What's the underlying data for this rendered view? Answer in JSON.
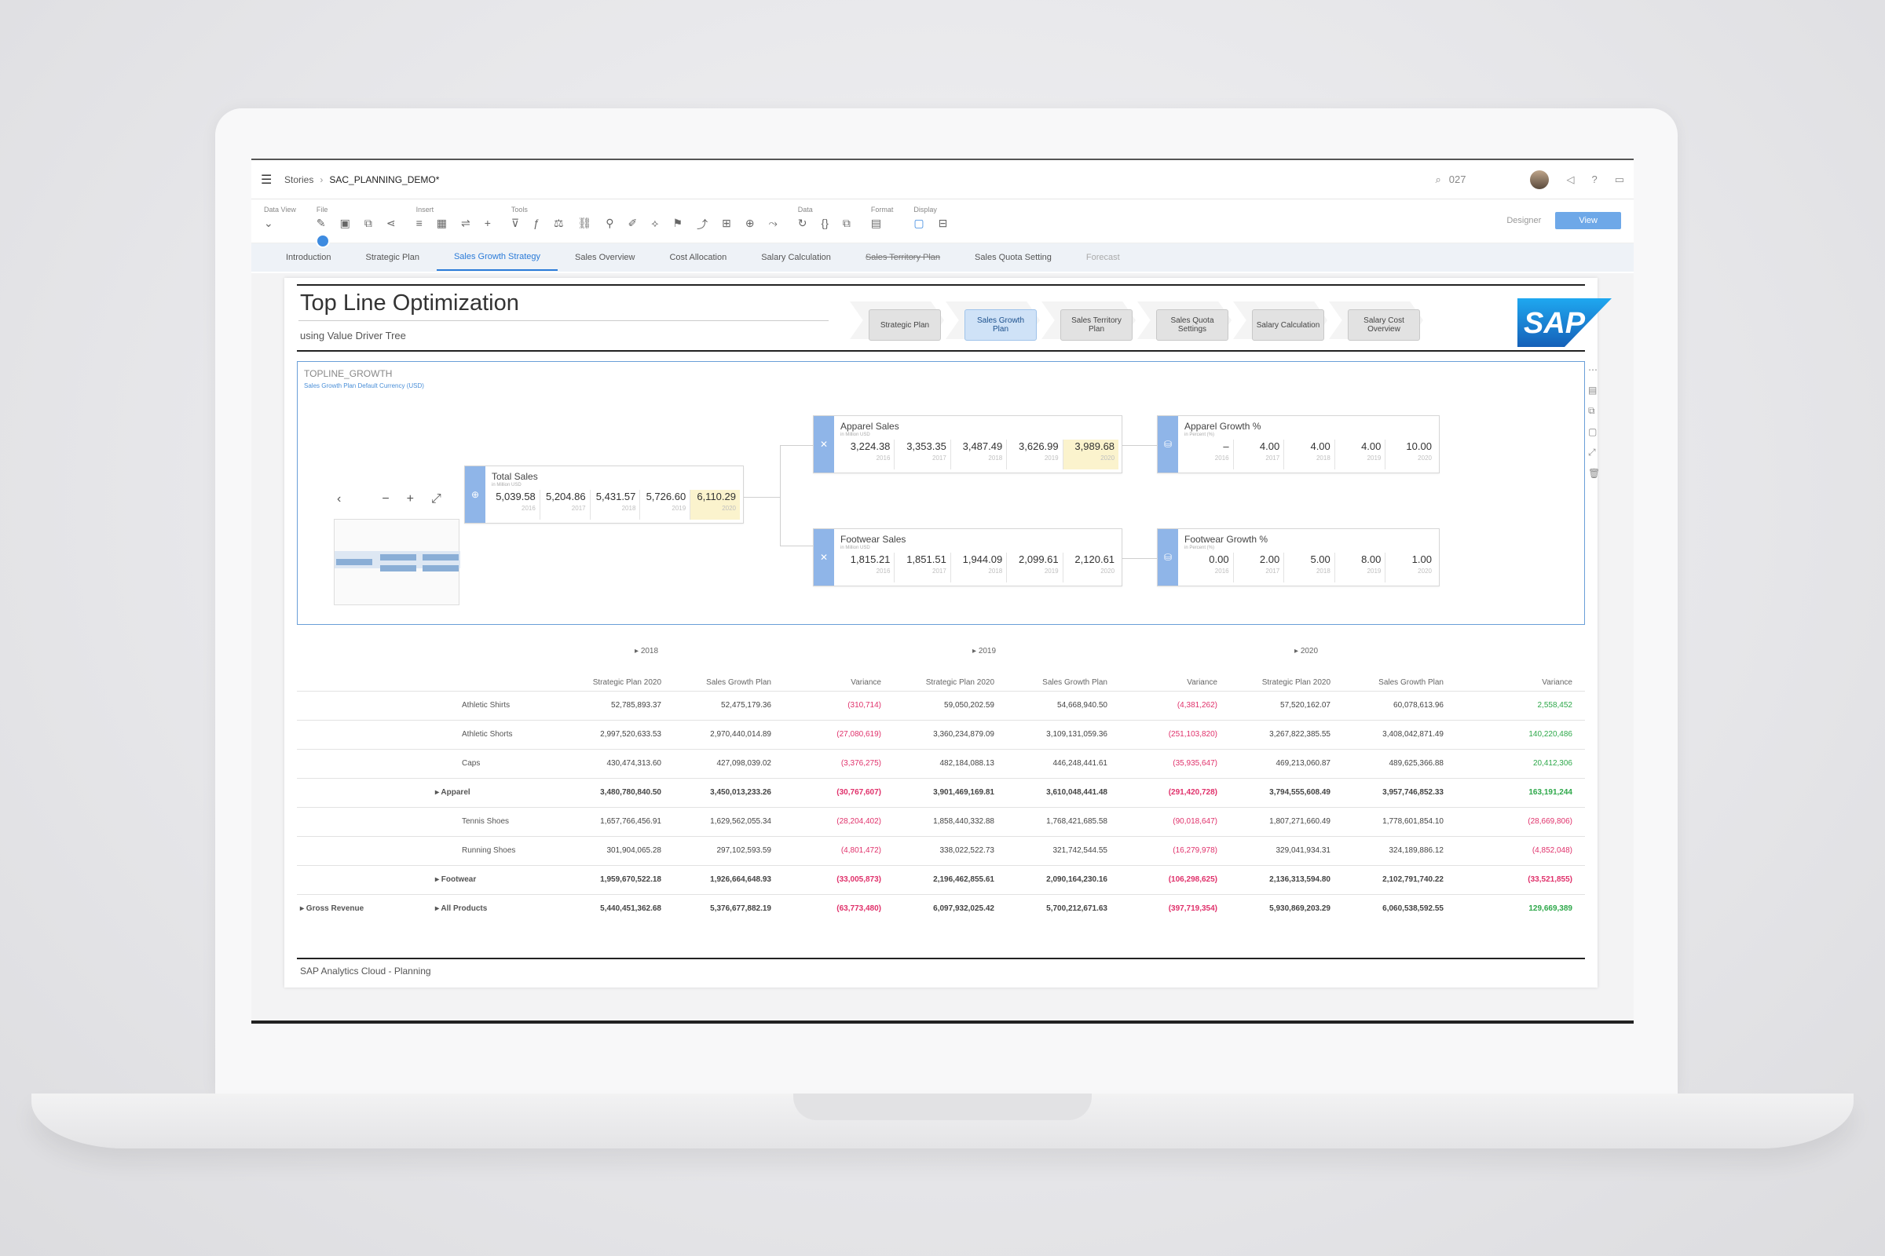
{
  "shell": {
    "breadcrumb_root": "Stories",
    "breadcrumb_current": "SAC_PLANNING_DEMO*",
    "search_value": "027"
  },
  "toolbar": {
    "data_view_label": "Data View",
    "file_label": "File",
    "insert_label": "Insert",
    "tools_label": "Tools",
    "data_label": "Data",
    "format_label": "Format",
    "display_label": "Display",
    "designer_label": "Designer",
    "view_label": "View"
  },
  "tabs": [
    {
      "label": "Introduction"
    },
    {
      "label": "Strategic Plan"
    },
    {
      "label": "Sales Growth Strategy"
    },
    {
      "label": "Sales Overview"
    },
    {
      "label": "Cost Allocation"
    },
    {
      "label": "Salary Calculation"
    },
    {
      "label": "Sales Territory Plan"
    },
    {
      "label": "Sales Quota Setting"
    },
    {
      "label": "Forecast"
    }
  ],
  "page": {
    "title": "Top Line Optimization",
    "subtitle": "using Value Driver Tree",
    "footer": "SAP Analytics Cloud - Planning"
  },
  "process": [
    {
      "label": "Strategic Plan"
    },
    {
      "label": "Sales Growth Plan"
    },
    {
      "label": "Sales Territory Plan"
    },
    {
      "label": "Sales Quota Settings"
    },
    {
      "label": "Salary Calculation"
    },
    {
      "label": "Salary Cost Overview"
    }
  ],
  "logo_text": "SAP",
  "vdt": {
    "title": "TOPLINE_GROWTH",
    "subtitle": "Sales Growth Plan   Default Currency (USD)",
    "nodes": {
      "total": {
        "name": "Total Sales",
        "unit": "in Million USD",
        "values": [
          "5,039.58",
          "5,204.86",
          "5,431.57",
          "5,726.60",
          "6,110.29"
        ],
        "years": [
          "2016",
          "2017",
          "2018",
          "2019",
          "2020"
        ]
      },
      "apparel": {
        "name": "Apparel Sales",
        "unit": "in Million USD",
        "values": [
          "3,224.38",
          "3,353.35",
          "3,487.49",
          "3,626.99",
          "3,989.68"
        ],
        "years": [
          "2016",
          "2017",
          "2018",
          "2019",
          "2020"
        ]
      },
      "footwear": {
        "name": "Footwear Sales",
        "unit": "in Million USD",
        "values": [
          "1,815.21",
          "1,851.51",
          "1,944.09",
          "2,099.61",
          "2,120.61"
        ],
        "years": [
          "2016",
          "2017",
          "2018",
          "2019",
          "2020"
        ]
      },
      "apparel_growth": {
        "name": "Apparel Growth %",
        "unit": "in Percent (%)",
        "values": [
          "–",
          "4.00",
          "4.00",
          "4.00",
          "10.00"
        ],
        "years": [
          "2016",
          "2017",
          "2018",
          "2019",
          "2020"
        ]
      },
      "footwear_growth": {
        "name": "Footwear Growth %",
        "unit": "in Percent (%)",
        "values": [
          "0.00",
          "2.00",
          "5.00",
          "8.00",
          "1.00"
        ],
        "years": [
          "2016",
          "2017",
          "2018",
          "2019",
          "2020"
        ]
      }
    }
  },
  "table": {
    "years": [
      "2018",
      "2019",
      "2020"
    ],
    "columns": [
      "Strategic Plan 2020",
      "Sales Growth Plan",
      "Variance"
    ],
    "rows": [
      {
        "l1": "",
        "l2": "Athletic Shirts",
        "v": [
          "52,785,893.37",
          "52,475,179.36",
          "(310,714)",
          "59,050,202.59",
          "54,668,940.50",
          "(4,381,262)",
          "57,520,162.07",
          "60,078,613.96",
          "2,558,452"
        ]
      },
      {
        "l1": "",
        "l2": "Athletic Shorts",
        "v": [
          "2,997,520,633.53",
          "2,970,440,014.89",
          "(27,080,619)",
          "3,360,234,879.09",
          "3,109,131,059.36",
          "(251,103,820)",
          "3,267,822,385.55",
          "3,408,042,871.49",
          "140,220,486"
        ]
      },
      {
        "l1": "",
        "l2": "Caps",
        "v": [
          "430,474,313.60",
          "427,098,039.02",
          "(3,376,275)",
          "482,184,088.13",
          "446,248,441.61",
          "(35,935,647)",
          "469,213,060.87",
          "489,625,366.88",
          "20,412,306"
        ]
      },
      {
        "l1": "",
        "l2": "▸ Apparel",
        "v": [
          "3,480,780,840.50",
          "3,450,013,233.26",
          "(30,767,607)",
          "3,901,469,169.81",
          "3,610,048,441.48",
          "(291,420,728)",
          "3,794,555,608.49",
          "3,957,746,852.33",
          "163,191,244"
        ]
      },
      {
        "l1": "",
        "l2": "Tennis Shoes",
        "v": [
          "1,657,766,456.91",
          "1,629,562,055.34",
          "(28,204,402)",
          "1,858,440,332.88",
          "1,768,421,685.58",
          "(90,018,647)",
          "1,807,271,660.49",
          "1,778,601,854.10",
          "(28,669,806)"
        ]
      },
      {
        "l1": "",
        "l2": "Running Shoes",
        "v": [
          "301,904,065.28",
          "297,102,593.59",
          "(4,801,472)",
          "338,022,522.73",
          "321,742,544.55",
          "(16,279,978)",
          "329,041,934.31",
          "324,189,886.12",
          "(4,852,048)"
        ]
      },
      {
        "l1": "",
        "l2": "▸ Footwear",
        "v": [
          "1,959,670,522.18",
          "1,926,664,648.93",
          "(33,005,873)",
          "2,196,462,855.61",
          "2,090,164,230.16",
          "(106,298,625)",
          "2,136,313,594.80",
          "2,102,791,740.22",
          "(33,521,855)"
        ]
      },
      {
        "l1": "▸ Gross Revenue",
        "l2": "▸ All Products",
        "v": [
          "5,440,451,362.68",
          "5,376,677,882.19",
          "(63,773,480)",
          "6,097,932,025.42",
          "5,700,212,671.63",
          "(397,719,354)",
          "5,930,869,203.29",
          "6,060,538,592.55",
          "129,669,389"
        ]
      }
    ]
  }
}
